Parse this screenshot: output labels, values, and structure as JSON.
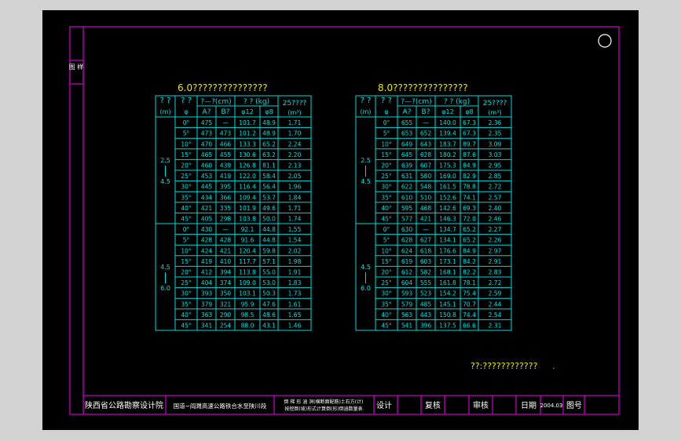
{
  "left_table": {
    "title": "6.0???????????????",
    "header": {
      "h1": "? ?",
      "h1b": "(m)",
      "h2": "? ?",
      "h2b": "φ",
      "h3": "?—?(cm)",
      "h3a": "A?",
      "h3b": "B?",
      "h4": "? ? (kg)",
      "h4a": "φ12",
      "h4b": "φ8",
      "h5": "25????",
      "h5b": "(m³)"
    },
    "groups": [
      {
        "label_top": "2.5",
        "label_bot": "4.5",
        "rows": [
          [
            "0°",
            "475",
            "—",
            "101.7",
            "48.9",
            "1.71"
          ],
          [
            "5°",
            "473",
            "473",
            "101.2",
            "48.9",
            "1.70"
          ],
          [
            "10°",
            "470",
            "466",
            "133.3",
            "65.2",
            "2.24"
          ],
          [
            "15°",
            "465",
            "455",
            "130.6",
            "63.2",
            "2.20"
          ],
          [
            "20°",
            "460",
            "439",
            "126.8",
            "81.1",
            "2.13"
          ],
          [
            "25°",
            "453",
            "419",
            "122.0",
            "58.4",
            "2.05"
          ],
          [
            "30°",
            "445",
            "395",
            "116.4",
            "56.4",
            "1.96"
          ],
          [
            "35°",
            "434",
            "366",
            "109.4",
            "53.7",
            "1.84"
          ],
          [
            "40°",
            "421",
            "335",
            "101.9",
            "49.6",
            "1.71"
          ],
          [
            "45°",
            "405",
            "298",
            "103.8",
            "50.0",
            "1.74"
          ]
        ]
      },
      {
        "label_top": "4.5",
        "label_bot": "6.0",
        "rows": [
          [
            "0°",
            "430",
            "—",
            "92.1",
            "44.8",
            "1.55"
          ],
          [
            "5°",
            "428",
            "428",
            "91.6",
            "44.8",
            "1.54"
          ],
          [
            "10°",
            "424",
            "421",
            "120.4",
            "59.8",
            "2.02"
          ],
          [
            "15°",
            "419",
            "410",
            "117.7",
            "57.1",
            "1.98"
          ],
          [
            "20°",
            "412",
            "394",
            "113.8",
            "55.0",
            "1.91"
          ],
          [
            "25°",
            "404",
            "374",
            "109.0",
            "53.0",
            "1.83"
          ],
          [
            "30°",
            "393",
            "350",
            "103.1",
            "50.3",
            "1.73"
          ],
          [
            "35°",
            "379",
            "321",
            "95.9",
            "47.6",
            "1.61"
          ],
          [
            "40°",
            "363",
            "290",
            "98.5",
            "48.6",
            "1.65"
          ],
          [
            "45°",
            "341",
            "254",
            "88.0",
            "43.1",
            "1.46"
          ]
        ]
      }
    ]
  },
  "right_table": {
    "title": "8.0???????????????",
    "header": {
      "h1": "? ?",
      "h1b": "(m)",
      "h2": "? ?",
      "h2b": "φ",
      "h3": "?—?(cm)",
      "h3a": "A?",
      "h3b": "B?",
      "h4": "? ? (kg)",
      "h4a": "φ12",
      "h4b": "φ8",
      "h5": "25????",
      "h5b": "(m³)"
    },
    "groups": [
      {
        "label_top": "2.5",
        "label_bot": "4.5",
        "rows": [
          [
            "0°",
            "655",
            "—",
            "140.0",
            "67.3",
            "2.36"
          ],
          [
            "5°",
            "653",
            "652",
            "139.4",
            "67.3",
            "2.35"
          ],
          [
            "10°",
            "649",
            "643",
            "183.7",
            "89.7",
            "3.09"
          ],
          [
            "15°",
            "645",
            "628",
            "180.2",
            "87.6",
            "3.03"
          ],
          [
            "20°",
            "639",
            "607",
            "175.3",
            "84.9",
            "2.95"
          ],
          [
            "25°",
            "631",
            "580",
            "169.0",
            "82.9",
            "2.85"
          ],
          [
            "30°",
            "622",
            "548",
            "161.5",
            "78.8",
            "2.72"
          ],
          [
            "35°",
            "610",
            "510",
            "152.6",
            "74.1",
            "2.57"
          ],
          [
            "40°",
            "595",
            "468",
            "142.6",
            "69.3",
            "2.40"
          ],
          [
            "45°",
            "577",
            "421",
            "146.3",
            "72.0",
            "2.46"
          ]
        ]
      },
      {
        "label_top": "4.5",
        "label_bot": "6.0",
        "rows": [
          [
            "0°",
            "630",
            "—",
            "134.7",
            "65.2",
            "2.27"
          ],
          [
            "5°",
            "628",
            "627",
            "134.1",
            "65.2",
            "2.26"
          ],
          [
            "10°",
            "624",
            "618",
            "176.6",
            "84.9",
            "2.97"
          ],
          [
            "15°",
            "619",
            "603",
            "173.1",
            "84.2",
            "2.91"
          ],
          [
            "20°",
            "612",
            "582",
            "168.1",
            "82.2",
            "2.83"
          ],
          [
            "25°",
            "604",
            "555",
            "161.8",
            "78.1",
            "2.72"
          ],
          [
            "30°",
            "593",
            "523",
            "154.2",
            "75.4",
            "2.59"
          ],
          [
            "35°",
            "579",
            "485",
            "145.1",
            "70.7",
            "2.44"
          ],
          [
            "40°",
            "563",
            "443",
            "150.8",
            "74.4",
            "2.54"
          ],
          [
            "45°",
            "541",
            "396",
            "137.5",
            "66.6",
            "2.31"
          ]
        ]
      }
    ]
  },
  "note": "??:????????????",
  "note_dot": ".",
  "side_tab": "图\n样",
  "title_block": {
    "org": "陕西省公路勘察设计院",
    "project": "国道~阎濉高速公路铁合水至陕川段",
    "drawing_line1": "倒 梯 形 涵 洞(横断面配筋)土石方(计)",
    "drawing_line2": "按挖倒(坡)形式计算倒(形)倒涵数量表",
    "design": "设计",
    "check": "复核",
    "review": "审核",
    "date_label": "日期",
    "date_value": "2004.03",
    "drawing_no": "图号"
  }
}
